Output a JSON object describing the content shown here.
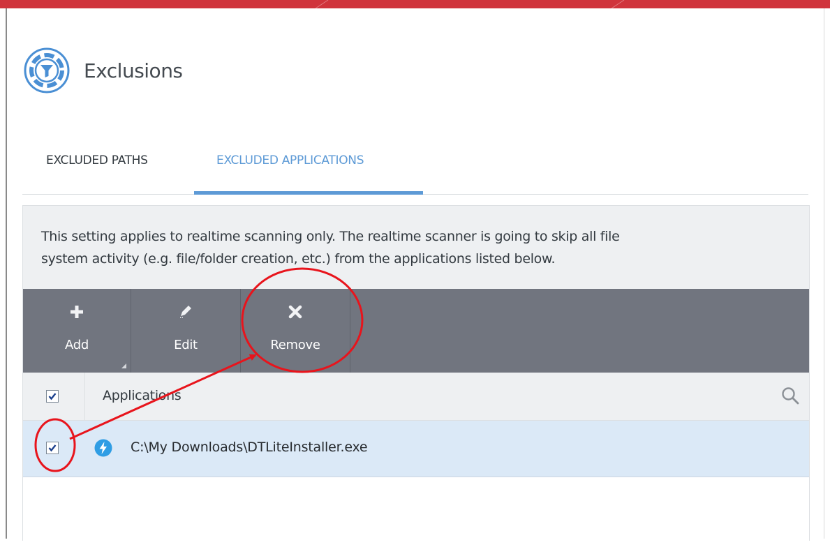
{
  "window": {
    "title": "Exclusions",
    "title_icon": "exclusions-filter-icon"
  },
  "tabs": [
    {
      "label": "EXCLUDED PATHS",
      "active": false
    },
    {
      "label": "EXCLUDED APPLICATIONS",
      "active": true
    }
  ],
  "panel": {
    "description_line1": "This setting applies to realtime scanning only. The realtime scanner is going to skip all file",
    "description_line2": "system activity (e.g. file/folder creation, etc.) from the applications listed below."
  },
  "toolbar": {
    "items": [
      {
        "label": "Add",
        "icon": "plus-icon"
      },
      {
        "label": "Edit",
        "icon": "pencil-icon"
      },
      {
        "label": "Remove",
        "icon": "x-icon"
      }
    ]
  },
  "table": {
    "column_header": "Applications",
    "header_checked": true,
    "rows": [
      {
        "path": "C:\\My Downloads\\DTLiteInstaller.exe",
        "checked": true,
        "icon": "application-bolt-icon"
      }
    ]
  },
  "colors": {
    "accent": "#5d9ad6",
    "toolbar": "#71757f",
    "selected_row": "#dbe9f7",
    "annotation": "#e8141c",
    "top_bar": "#d0343c"
  }
}
